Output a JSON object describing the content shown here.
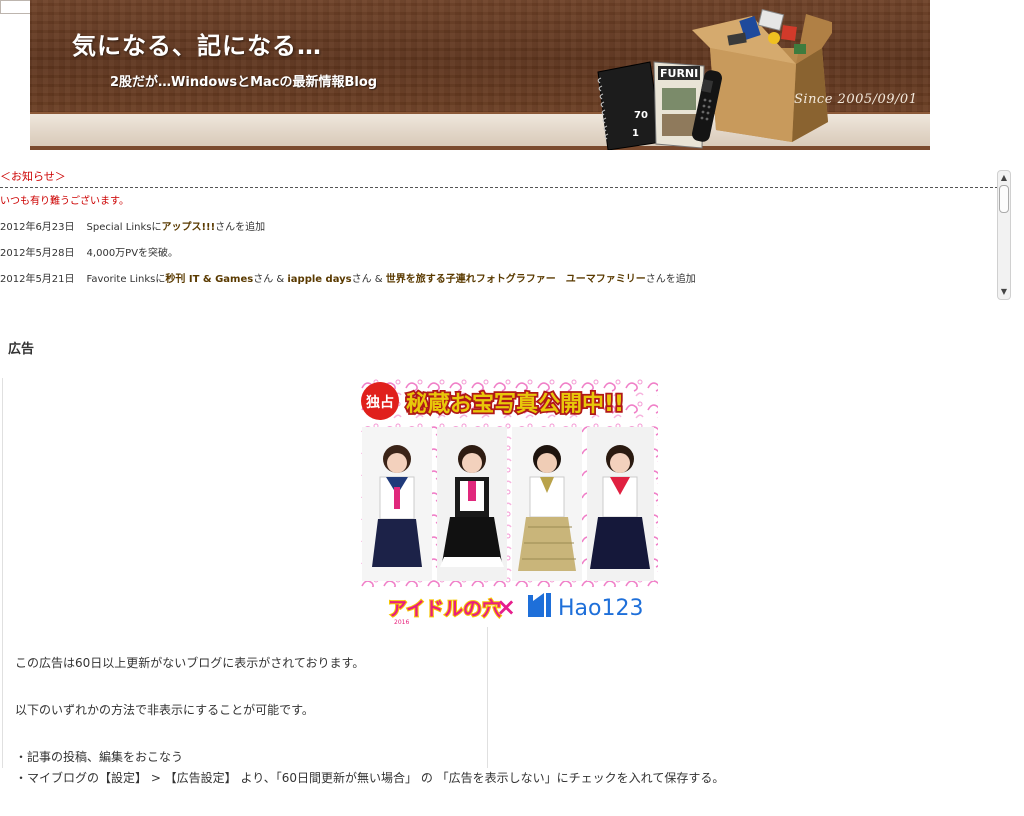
{
  "header": {
    "title": "気になる、記になる…",
    "subtitle": "2股だが…WindowsとMacの最新情報Blog",
    "since": "Since 2005/09/01",
    "notebook_number": "70",
    "notebook_small": "1",
    "magazine_label": "FURNI"
  },
  "notice": {
    "title": "＜お知らせ＞",
    "thanks": "いつも有り難うございます。",
    "items": [
      {
        "date": "2012年6月23日",
        "pre": "Special Linksに",
        "link1": "アップス!!!",
        "mid1": "さんを追加",
        "link2": "",
        "mid2": "",
        "link3": "",
        "post": ""
      },
      {
        "date": "2012年5月28日",
        "pre": "4,000万PVを突破。",
        "link1": "",
        "mid1": "",
        "link2": "",
        "mid2": "",
        "link3": "",
        "post": ""
      },
      {
        "date": "2012年5月21日",
        "pre": "Favorite Linksに",
        "link1": "秒刊 IT & Games",
        "mid1": "さん & ",
        "link2": "iapple days",
        "mid2": "さん & ",
        "link3": "世界を旅する子連れフォトグラファー　ユーマファミリー",
        "post": "さんを追加"
      }
    ]
  },
  "ad": {
    "heading": "広告",
    "banner": {
      "exclusive_badge": "独占",
      "headline": "秘蔵お宝写真公開中!!",
      "logo_left": "アイドルの穴",
      "logo_year": "2016",
      "cross": "×",
      "logo_right": "Hao123"
    },
    "text1": "この広告は60日以上更新がないブログに表示がされております。",
    "text2": "以下のいずれかの方法で非表示にすることが可能です。",
    "text3": "・記事の投稿、編集をおこなう",
    "text4": "・マイブログの【設定】 > 【広告設定】 より、「60日間更新が無い場合」 の 「広告を表示しない」にチェックを入れて保存する。"
  },
  "colors": {
    "notice_red": "#cc0000",
    "link_brown": "#5a3a00",
    "wood_dark": "#5e351e",
    "pink_accent": "#e61e8c",
    "hao_blue": "#1e6fd9"
  }
}
